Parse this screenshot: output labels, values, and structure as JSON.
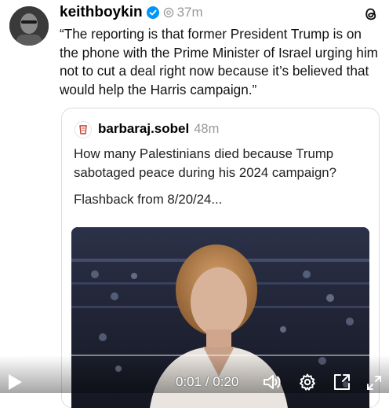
{
  "post": {
    "username": "keithboykin",
    "time": "37m",
    "text": "“The reporting is that former President Trump is on the phone with the Prime Minister of Israel urging him not to cut a deal right now because it’s believed that would help the Harris campaign.”"
  },
  "quote": {
    "username": "barbaraj.sobel",
    "time": "48m",
    "text_line1": "How many Palestinians died because Trump sabotaged peace during his 2024 campaign?",
    "text_line2": "Flashback from 8/20/24..."
  },
  "video": {
    "current_time": "0:01",
    "separator": "/",
    "duration": "0:20",
    "progress_fraction": 0.05
  },
  "icons": {
    "verified": "verified-badge-icon",
    "threads": "threads-logo-icon",
    "play": "play-icon",
    "volume": "volume-icon",
    "settings": "gear-icon",
    "pip": "picture-in-picture-icon",
    "fullscreen": "fullscreen-icon"
  },
  "colors": {
    "verified_blue": "#0095f6",
    "muted_text": "#999999",
    "card_border": "#dcdcdc"
  }
}
